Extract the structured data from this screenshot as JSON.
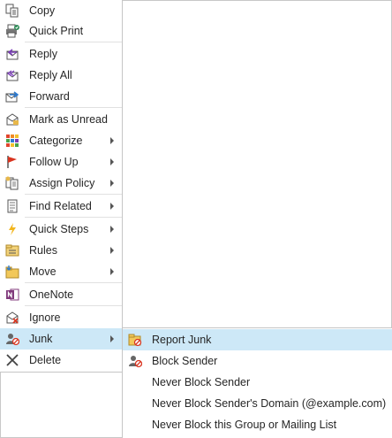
{
  "context_menu": {
    "items": [
      {
        "label": "Copy",
        "icon": "copy-icon"
      },
      {
        "label": "Quick Print",
        "icon": "quick-print-icon"
      },
      {
        "label": "Reply",
        "icon": "reply-icon"
      },
      {
        "label": "Reply All",
        "icon": "reply-all-icon"
      },
      {
        "label": "Forward",
        "icon": "forward-icon"
      },
      {
        "label": "Mark as Unread",
        "icon": "mark-unread-icon"
      },
      {
        "label": "Categorize",
        "icon": "categorize-icon",
        "submenu": true
      },
      {
        "label": "Follow Up",
        "icon": "flag-icon",
        "submenu": true
      },
      {
        "label": "Assign Policy",
        "icon": "policy-icon",
        "submenu": true
      },
      {
        "label": "Find Related",
        "icon": "find-related-icon",
        "submenu": true
      },
      {
        "label": "Quick Steps",
        "icon": "lightning-icon",
        "submenu": true
      },
      {
        "label": "Rules",
        "icon": "rules-icon",
        "submenu": true
      },
      {
        "label": "Move",
        "icon": "move-icon",
        "submenu": true
      },
      {
        "label": "OneNote",
        "icon": "onenote-icon"
      },
      {
        "label": "Ignore",
        "icon": "ignore-icon"
      },
      {
        "label": "Junk",
        "icon": "junk-icon",
        "submenu": true,
        "highlighted": true
      },
      {
        "label": "Delete",
        "icon": "delete-icon"
      }
    ]
  },
  "junk_submenu": {
    "items": [
      {
        "label": "Report Junk",
        "icon": "report-junk-icon",
        "highlighted": true
      },
      {
        "label": "Block Sender",
        "icon": "block-sender-icon"
      },
      {
        "label": "Never Block Sender"
      },
      {
        "label": "Never Block Sender's Domain (@example.com)"
      },
      {
        "label": "Never Block this Group or Mailing List"
      }
    ]
  },
  "colors": {
    "highlight": "#cde8f7",
    "menu_border": "#c6c6c6"
  }
}
